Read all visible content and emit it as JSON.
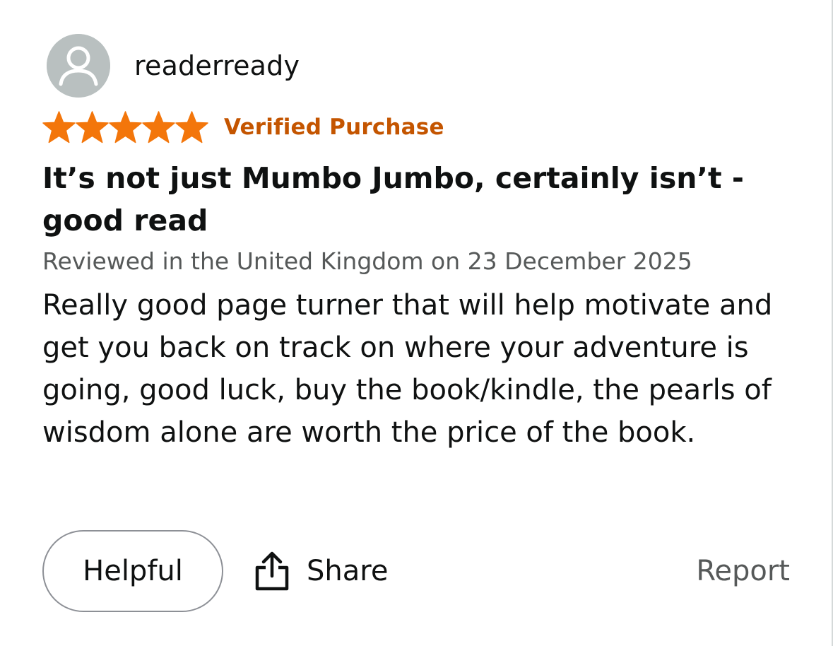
{
  "review": {
    "username": "readerready",
    "rating": 5,
    "rating_max": 5,
    "verified_label": "Verified Purchase",
    "title": "It’s not just Mumbo Jumbo, certainly isn’t - good read",
    "meta": "Reviewed in the United Kingdom on 23 December 2025",
    "body": "Really good page turner that will help motivate and get you back on track on where your adventure is going, good luck, buy the book/kindle, the pearls of wisdom alone are worth the price of the book."
  },
  "actions": {
    "helpful_label": "Helpful",
    "share_label": "Share",
    "report_label": "Report"
  },
  "icons": {
    "avatar": "user-avatar-icon",
    "star": "star-icon",
    "share": "share-icon"
  },
  "colors": {
    "star": "#f3760b",
    "verified": "#c45500",
    "meta_text": "#565959",
    "avatar_bg": "#b9c0c0",
    "button_border": "#8d9096"
  }
}
